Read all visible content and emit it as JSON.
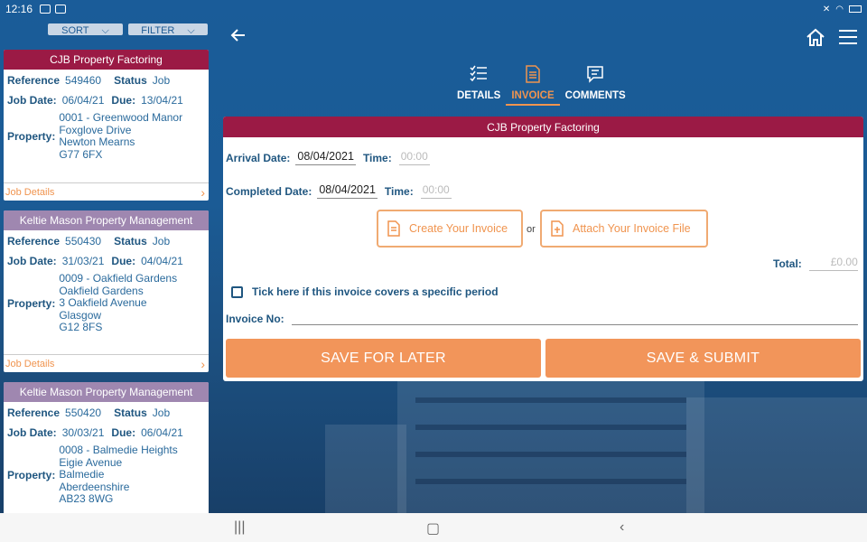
{
  "status_bar": {
    "time": "12:16"
  },
  "left_panel": {
    "sort_label": "SORT",
    "filter_label": "FILTER",
    "job_details_label": "Job Details",
    "labels": {
      "reference": "Reference",
      "status": "Status",
      "job_date": "Job Date:",
      "due": "Due:",
      "property": "Property:"
    },
    "cards": [
      {
        "company": "CJB Property Factoring",
        "header_color": "#9b1a45",
        "reference": "549460",
        "status": "Job",
        "job_date": "06/04/21",
        "due": "13/04/21",
        "property_lines": [
          "0001 - Greenwood Manor",
          "Foxglove Drive",
          "Newton Mearns",
          "G77 6FX"
        ]
      },
      {
        "company": "Keltie Mason Property Management",
        "header_color": "#9f87b0",
        "reference": "550430",
        "status": "Job",
        "job_date": "31/03/21",
        "due": "04/04/21",
        "property_lines": [
          "0009 - Oakfield Gardens",
          "Oakfield Gardens",
          "3 Oakfield Avenue",
          "Glasgow",
          "G12 8FS"
        ]
      },
      {
        "company": "Keltie Mason Property Management",
        "header_color": "#9f87b0",
        "reference": "550420",
        "status": "Job",
        "job_date": "30/03/21",
        "due": "06/04/21",
        "property_lines": [
          "0008 - Balmedie Heights",
          "Eigie Avenue",
          "Balmedie",
          "Aberdeenshire",
          "AB23 8WG"
        ]
      }
    ]
  },
  "tabs": [
    {
      "label": "DETAILS",
      "icon": "checklist-icon",
      "active": false
    },
    {
      "label": "INVOICE",
      "icon": "document-icon",
      "active": true
    },
    {
      "label": "COMMENTS",
      "icon": "comment-icon",
      "active": false
    }
  ],
  "form": {
    "company": "CJB Property Factoring",
    "arrival_label": "Arrival Date:",
    "arrival_date": "08/04/2021",
    "time_label": "Time:",
    "arrival_time": "00:00",
    "completed_label": "Completed Date:",
    "completed_date": "08/04/2021",
    "completed_time": "00:00",
    "create_invoice_label": "Create Your Invoice",
    "or_label": "or",
    "attach_invoice_label": "Attach Your Invoice File",
    "total_label": "Total:",
    "total_value": "£0.00",
    "period_checkbox_label": "Tick here if this invoice covers a specific period",
    "period_checked": false,
    "invoice_no_label": "Invoice No:",
    "invoice_no_value": "",
    "save_later_label": "SAVE FOR LATER",
    "save_submit_label": "SAVE & SUBMIT"
  },
  "colors": {
    "accent": "#f0944f",
    "brand_red": "#9b1a45",
    "brand_purple": "#9f87b0",
    "primary_blue": "#1f5680"
  }
}
